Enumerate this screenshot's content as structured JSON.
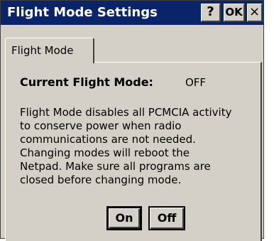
{
  "window": {
    "title": "Flight Mode Settings",
    "help_label": "?",
    "ok_label": "OK",
    "close_label": "×"
  },
  "tabs": [
    {
      "label": "Flight Mode"
    }
  ],
  "panel": {
    "current_mode_label": "Current Flight Mode:",
    "current_mode_value": "OFF",
    "description_lines": [
      "Flight Mode disables all PCMCIA activity",
      "to conserve power when radio",
      "communications are not needed.",
      "Changing modes will reboot the",
      "Netpad. Make sure all programs are",
      "closed before changing mode."
    ],
    "on_button_label": "On",
    "off_button_label": "Off"
  },
  "colors": {
    "titlebar": "#0a246a",
    "face": "#d4d0c8",
    "title_text": "#ffffff"
  }
}
